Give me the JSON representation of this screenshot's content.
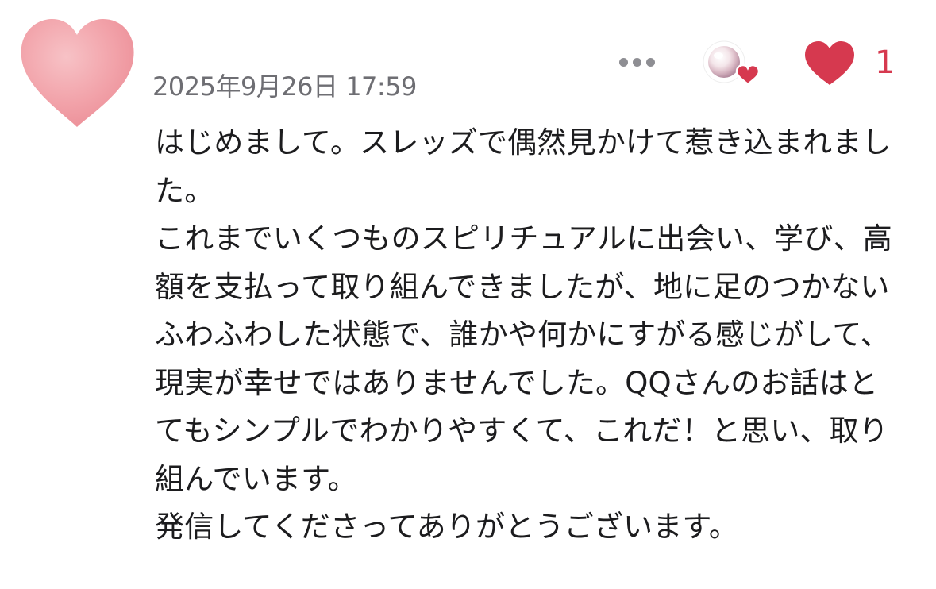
{
  "comment": {
    "timestamp": "2025年9月26日 17:59",
    "like_count": "1",
    "body": "はじめまして。スレッズで偶然見かけて惹き込まれました。\nこれまでいくつものスピリチュアルに出会い、学び、高額を支払って取り組んできましたが、地に足のつかないふわふわした状態で、誰かや何かにすがる感じがして、現実が幸せではありませんでした。QQさんのお話はとてもシンプルでわかりやすくて、これだ！と思い、取り組んでいます。\n発信してくださってありがとうございます。"
  },
  "icons": {
    "avatar": "heart-avatar",
    "more": "more-horizontal-icon",
    "author_like": "pearl-heart-badge",
    "like": "heart-icon"
  },
  "colors": {
    "like_red": "#d6394f",
    "avatar_pink": "#f2a0a8",
    "timestamp_gray": "#6e6e73",
    "text": "#1c1c1e"
  }
}
